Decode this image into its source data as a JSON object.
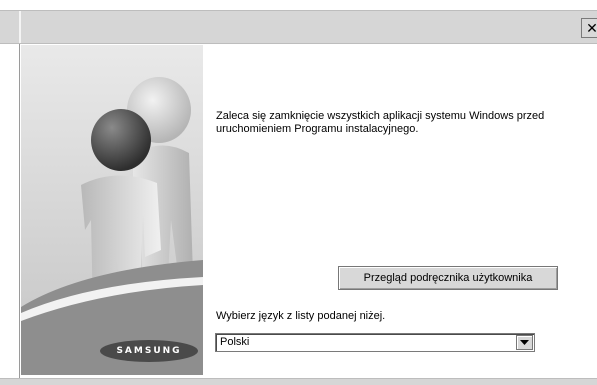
{
  "titlebar": {
    "close_icon": "close-icon"
  },
  "message": {
    "line1": "Zaleca się zamknięcie wszystkich aplikacji systemu Windows przed",
    "line2": "uruchomieniem Programu instalacyjnego."
  },
  "buttons": {
    "user_guide": "Przegląd podręcznika użytkownika"
  },
  "language": {
    "label": "Wybierz język z listy podanej niżej.",
    "selected": "Polski"
  },
  "brand": {
    "logo_text": "SAMSUNG"
  },
  "colors": {
    "panel_gray": "#cfcfcf",
    "titlebar_gray": "#d6d6d6"
  }
}
